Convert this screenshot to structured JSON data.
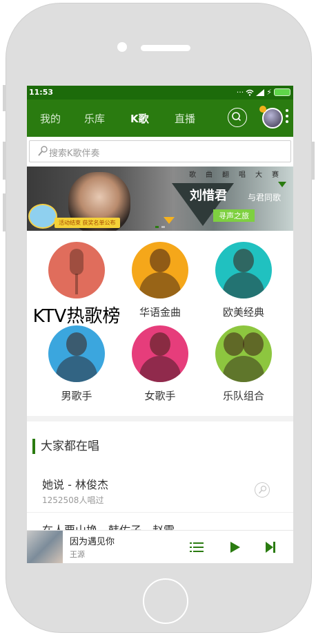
{
  "statusbar": {
    "time": "11:53"
  },
  "nav": {
    "tabs": [
      {
        "label": "我的"
      },
      {
        "label": "乐库"
      },
      {
        "label": "K歌"
      },
      {
        "label": "直播"
      }
    ],
    "active_tab": "K歌"
  },
  "search": {
    "placeholder": "搜索K歌伴奏"
  },
  "banner": {
    "top_chars": [
      "歌",
      "曲",
      "翻",
      "唱",
      "大",
      "赛"
    ],
    "main_text": "刘惜君",
    "song_title": "与君同歌",
    "subtitle": "寻声之旅",
    "promo": "活动结束 获奖名单公布"
  },
  "categories": [
    {
      "label": "KTV热歌榜",
      "color": "#e06d5c"
    },
    {
      "label": "华语金曲",
      "color": "#f5a71a"
    },
    {
      "label": "欧美经典",
      "color": "#20c1c0"
    },
    {
      "label": "男歌手",
      "color": "#3ba6de"
    },
    {
      "label": "女歌手",
      "color": "#e63d7b"
    },
    {
      "label": "乐队组合",
      "color": "#8dc63f"
    }
  ],
  "section": {
    "title": "大家都在唱"
  },
  "songs": [
    {
      "name": "她说 - 林俊杰",
      "count": "1252508人唱过"
    },
    {
      "name": "在人要山换 - 韩佐子、赵雷"
    }
  ],
  "player": {
    "title": "因为遇见你",
    "artist": "王源"
  },
  "colors": {
    "accent": "#2a7b10",
    "status": "#1c6b0a"
  }
}
